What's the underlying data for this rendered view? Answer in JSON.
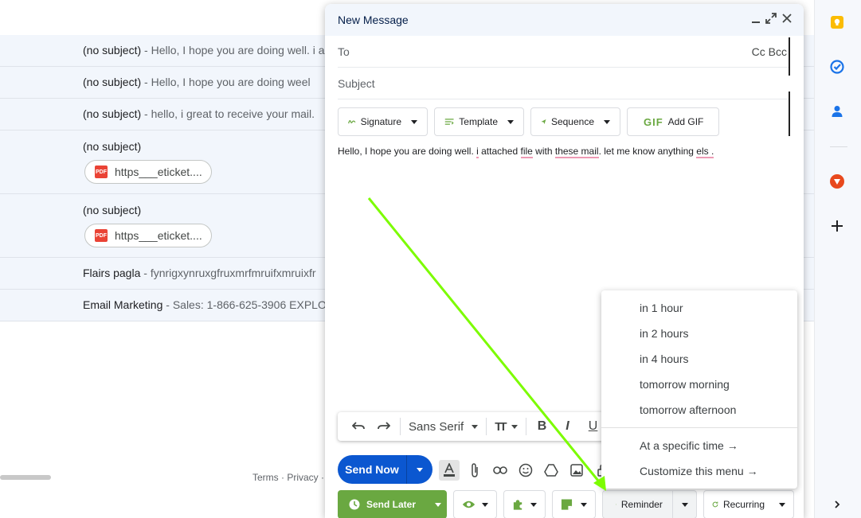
{
  "inbox": {
    "rows": [
      {
        "subject": "(no subject)",
        "snippet": " - Hello, I hope you are doing well. i a"
      },
      {
        "subject": "(no subject)",
        "snippet": " - Hello, I hope you are doing weel"
      },
      {
        "subject": "(no subject)",
        "snippet": " - hello, i great to receive your mail."
      },
      {
        "subject": "(no subject)",
        "snippet": "",
        "attachment": "https___eticket...."
      },
      {
        "subject": "(no subject)",
        "snippet": "",
        "attachment": "https___eticket...."
      },
      {
        "subject": "Flairs pagla",
        "snippet": " - fynrigxynruxgfruxmrfmruifxmruixfr"
      },
      {
        "subject": "Email Marketing",
        "snippet": " - Sales: 1-866-625-3906 EXPLO"
      }
    ],
    "pdf_label": "PDF",
    "footer": "Terms · Privacy ·"
  },
  "compose": {
    "title": "New Message",
    "to_label": "To",
    "cc_bcc": "Cc Bcc",
    "subject_placeholder": "Subject",
    "tools": {
      "signature": "Signature",
      "template": "Template",
      "sequence": "Sequence",
      "gif_badge": "GIF",
      "add_gif": "Add GIF"
    },
    "body": {
      "p1": "Hello, I hope you are doing well. ",
      "w1": "i",
      "p2": " attached ",
      "w2": "file",
      "p3": " with ",
      "w3": "these mail",
      "p4": ". let me know anything ",
      "w4": "els ."
    },
    "format": {
      "font": "Sans Serif",
      "size_glyph": "TT",
      "bold": "B",
      "italic": "I",
      "underline": "U"
    },
    "send_label": "Send Now",
    "send_later_label": "Send Later",
    "reminder_label": "Reminder",
    "recurring_label": "Recurring"
  },
  "reminder_menu": {
    "items": [
      "in 1 hour",
      "in 2 hours",
      "in 4 hours",
      "tomorrow morning",
      "tomorrow afternoon"
    ],
    "specific": "At a specific time →",
    "customize": "Customize this menu →"
  },
  "colors": {
    "send_blue": "#0b57d0",
    "send_later_green": "#6aa841",
    "arrow": "#7cfc00"
  }
}
